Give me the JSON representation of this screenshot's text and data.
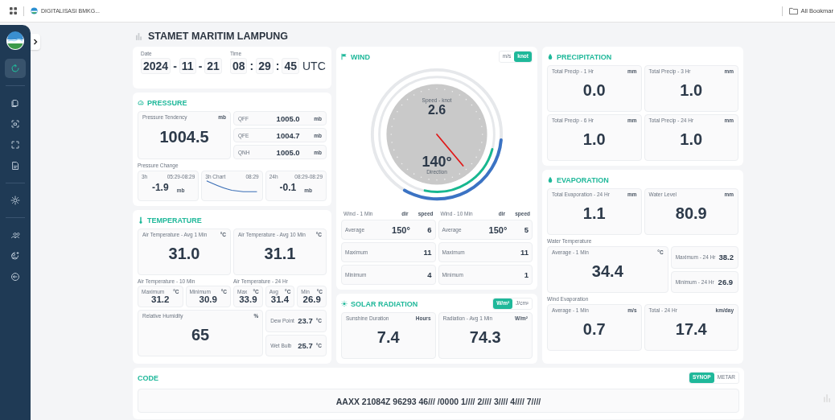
{
  "browser": {
    "bookmarks": [
      {
        "label": "DIGITALISASI BMKG..."
      }
    ],
    "all_bookmarks": "All Bookmar"
  },
  "sidebar": {
    "items": [
      {
        "selected": true
      },
      {
        "selected": false
      },
      {
        "selected": false
      },
      {
        "selected": false
      },
      {
        "selected": false
      },
      {
        "selected": false
      },
      {
        "selected": false
      },
      {
        "selected": false
      },
      {
        "selected": false
      }
    ]
  },
  "title": "STAMET MARITIM LAMPUNG",
  "datetime": {
    "date_label": "Date",
    "date": [
      {
        "kind": "box",
        "text": "2024"
      },
      {
        "kind": "sep",
        "text": "-"
      },
      {
        "kind": "box",
        "text": "11"
      },
      {
        "kind": "sep",
        "text": "-"
      },
      {
        "kind": "box",
        "text": "21"
      }
    ],
    "time_label": "Time",
    "time": [
      {
        "kind": "box",
        "text": "08"
      },
      {
        "kind": "sep",
        "text": ":"
      },
      {
        "kind": "box",
        "text": "29"
      },
      {
        "kind": "sep",
        "text": ":"
      },
      {
        "kind": "box",
        "text": "45"
      },
      {
        "kind": "zone",
        "text": "UTC"
      }
    ]
  },
  "pressure": {
    "title": "PRESSURE",
    "tendency": {
      "label": "Pressure Tendency",
      "unit": "mb",
      "value": "1004.5"
    },
    "readings": [
      {
        "label": "QFF",
        "value": "1005.0",
        "unit": "mb"
      },
      {
        "label": "QFE",
        "value": "1004.7",
        "unit": "mb"
      },
      {
        "label": "QNH",
        "value": "1005.0",
        "unit": "mb"
      }
    ],
    "change_label": "Pressure Change",
    "changes": [
      {
        "kind": "value",
        "label": "3h",
        "range": "05:29-08:29",
        "value": "-1.9",
        "unit": "mb"
      },
      {
        "kind": "chart",
        "label": "3h Chart",
        "range": "08:29"
      },
      {
        "kind": "value",
        "label": "24h",
        "range": "08:29-08:29",
        "value": "-0.1",
        "unit": "mb"
      }
    ]
  },
  "temperature": {
    "title": "TEMPERATURE",
    "averages": [
      {
        "label": "Air Temperature - Avg 1 Min",
        "unit": "°C",
        "value": "31.0"
      },
      {
        "label": "Air Temperature - Avg 10 Min",
        "unit": "°C",
        "value": "31.1"
      }
    ],
    "groups": [
      {
        "label": "Air Temperature - 10 Min",
        "cells": [
          {
            "label": "Maximum",
            "unit": "°C",
            "value": "31.2"
          },
          {
            "label": "Minimum",
            "unit": "°C",
            "value": "30.9"
          }
        ]
      },
      {
        "label": "Air Temperature - 24 Hr",
        "cells": [
          {
            "label": "Max",
            "unit": "°C",
            "value": "33.9"
          },
          {
            "label": "Avg",
            "unit": "°C",
            "value": "31.4"
          },
          {
            "label": "Min",
            "unit": "°C",
            "value": "26.9"
          }
        ]
      }
    ],
    "humidity": {
      "label": "Relative Humidity",
      "unit": "%",
      "value": "65"
    },
    "side": [
      {
        "label": "Dew Point",
        "value": "23.7",
        "unit": "°C"
      },
      {
        "label": "Wet Bulb",
        "value": "25.7",
        "unit": "°C"
      }
    ]
  },
  "wind": {
    "title": "WIND",
    "units": [
      {
        "label": "m/s",
        "selected": false
      },
      {
        "label": "knot",
        "selected": true
      }
    ],
    "gauge": {
      "speed_label": "Speed - knot",
      "speed": "2.6",
      "direction": "140°",
      "direction_label": "Direction"
    },
    "tables": [
      {
        "title": "Wind - 1 Min",
        "dir_header": "dir",
        "speed_header": "speed",
        "rows": [
          {
            "label": "Average",
            "dir": "150°",
            "speed": "6"
          },
          {
            "label": "Maximum",
            "speed": "11"
          },
          {
            "label": "Minimum",
            "speed": "4"
          }
        ]
      },
      {
        "title": "Wind - 10 Min",
        "dir_header": "dir",
        "speed_header": "speed",
        "rows": [
          {
            "label": "Average",
            "dir": "150°",
            "speed": "5"
          },
          {
            "label": "Maximum",
            "speed": "11"
          },
          {
            "label": "Minimum",
            "speed": "1"
          }
        ]
      }
    ]
  },
  "solar": {
    "title": "SOLAR RADIATION",
    "units": [
      {
        "label": "W/m²",
        "selected": true
      },
      {
        "label": "J/cm²",
        "selected": false
      }
    ],
    "cells": [
      {
        "label": "Sunshine Duration",
        "unit": "Hours",
        "value": "7.4"
      },
      {
        "label": "Radiation - Avg 1 Min",
        "unit": "W/m²",
        "value": "74.3"
      }
    ]
  },
  "precipitation": {
    "title": "PRECIPITATION",
    "cells": [
      {
        "label": "Total Precip - 1 Hr",
        "unit": "mm",
        "value": "0.0"
      },
      {
        "label": "Total Precip - 3 Hr",
        "unit": "mm",
        "value": "1.0"
      },
      {
        "label": "Total Precip - 6 Hr",
        "unit": "mm",
        "value": "1.0"
      },
      {
        "label": "Total Precip - 24 Hr",
        "unit": "mm",
        "value": "1.0"
      }
    ]
  },
  "evaporation": {
    "title": "EVAPORATION",
    "cells": [
      {
        "label": "Total Evaporation - 24 Hr",
        "unit": "mm",
        "value": "1.1"
      },
      {
        "label": "Water Level",
        "unit": "mm",
        "value": "80.9"
      }
    ],
    "water_temperature": {
      "label": "Water Temperature",
      "average": {
        "label": "Average - 1 Min",
        "unit": "°C",
        "value": "34.4"
      },
      "side": [
        {
          "label": "Maximum - 24 Hr",
          "value": "38.2"
        },
        {
          "label": "Minimum - 24 Hr",
          "value": "26.9"
        }
      ]
    },
    "wind_evaporation": {
      "label": "Wind Evaporation",
      "cells": [
        {
          "label": "Average - 1 Min",
          "unit": "m/s",
          "value": "0.7"
        },
        {
          "label": "Total - 24 Hr",
          "unit": "km/day",
          "value": "17.4"
        }
      ]
    }
  },
  "code": {
    "title": "CODE",
    "formats": [
      {
        "label": "SYNOP",
        "selected": true
      },
      {
        "label": "METAR",
        "selected": false
      }
    ],
    "text": "AAXX 21084Z 96293 46/// /0000 1//// 2//// 3//// 4//// 7////"
  }
}
